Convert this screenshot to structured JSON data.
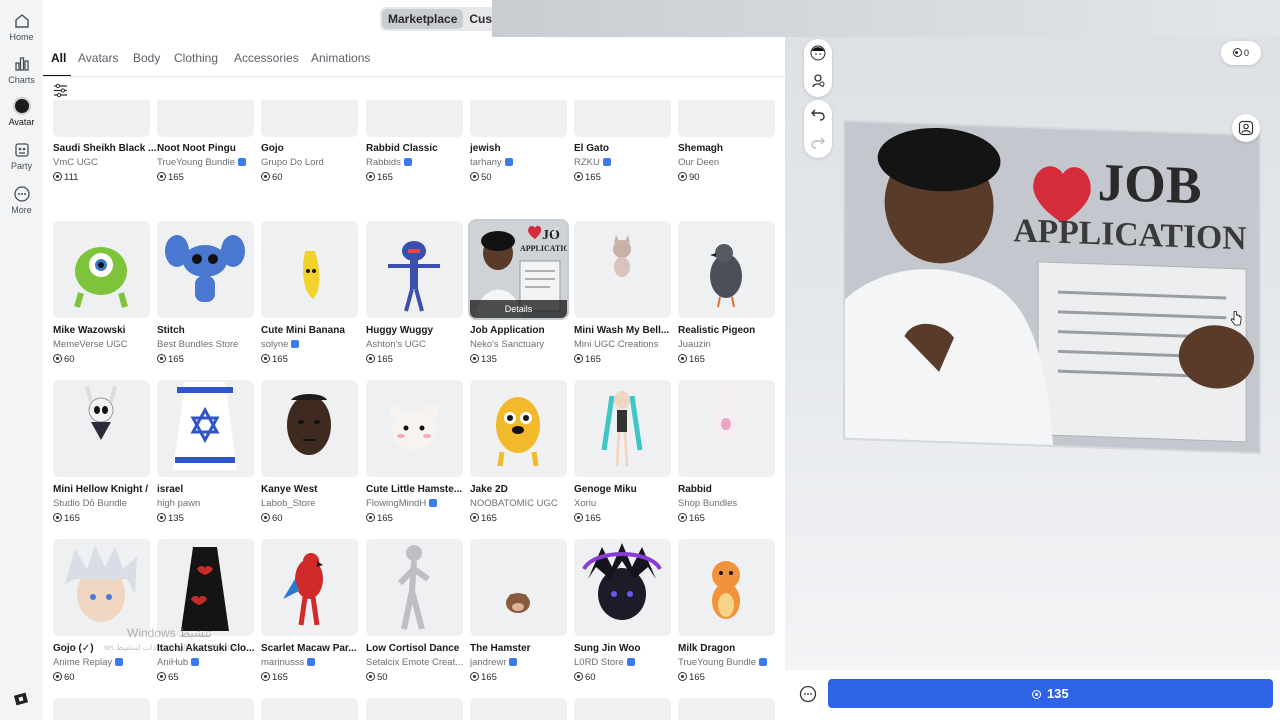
{
  "nav": {
    "items": [
      {
        "label": "Home",
        "icon": "home-icon"
      },
      {
        "label": "Charts",
        "icon": "charts-icon"
      },
      {
        "label": "Avatar",
        "icon": "avatar-icon"
      },
      {
        "label": "Party",
        "icon": "party-icon"
      },
      {
        "label": "More",
        "icon": "more-icon"
      }
    ],
    "active": "Avatar"
  },
  "topbar": {
    "marketplace_label": "Marketplace",
    "customize_label": "Customize",
    "active_tab": "Marketplace",
    "search_icon": "search-icon"
  },
  "categories": {
    "items": [
      "All",
      "Avatars",
      "Body",
      "Clothing",
      "Accessories",
      "Animations"
    ],
    "active": "All"
  },
  "items": [
    {
      "name": "Saudi Sheikh Black ...",
      "creator": "VmC UGC",
      "verified": false,
      "price": "111",
      "icon": "black-robe"
    },
    {
      "name": "Noot Noot Pingu",
      "creator": "TrueYoung Bundle",
      "verified": true,
      "price": "165",
      "icon": "penguin"
    },
    {
      "name": "Gojo",
      "creator": "Grupo Do Lord",
      "verified": false,
      "price": "60",
      "icon": "head-blindfold"
    },
    {
      "name": "Rabbid Classic",
      "creator": "Rabbids",
      "verified": true,
      "price": "165",
      "icon": "rabbit"
    },
    {
      "name": "jewish",
      "creator": "tarhany",
      "verified": true,
      "price": "50",
      "icon": "flag"
    },
    {
      "name": "El Gato",
      "creator": "RZKU",
      "verified": true,
      "price": "165",
      "icon": "cat"
    },
    {
      "name": "Shemagh",
      "creator": "Our Deen",
      "verified": false,
      "price": "90",
      "icon": "scarf"
    },
    {
      "name": "Mike Wazowski",
      "creator": "MemeVerse UGC",
      "verified": false,
      "price": "60",
      "icon": "green-monster"
    },
    {
      "name": "Stitch",
      "creator": "Best Bundles Store",
      "verified": false,
      "price": "165",
      "icon": "blue-alien"
    },
    {
      "name": "Cute Mini Banana",
      "creator": "solyne",
      "verified": true,
      "price": "165",
      "icon": "banana"
    },
    {
      "name": "Huggy Wuggy",
      "creator": "Ashton's UGC",
      "verified": false,
      "price": "165",
      "icon": "blue-figure"
    },
    {
      "name": "Job Application",
      "creator": "Neko's Sanctuary",
      "verified": false,
      "price": "135",
      "icon": "photo",
      "selected": true,
      "details_label": "Details"
    },
    {
      "name": "Mini Wash My Bell...",
      "creator": "Mini UGC Creations",
      "verified": false,
      "price": "165",
      "icon": "small-cat"
    },
    {
      "name": "Realistic Pigeon",
      "creator": "Juauzin",
      "verified": false,
      "price": "165",
      "icon": "pigeon"
    },
    {
      "name": "Mini Hellow Knight /",
      "creator": "Studio Dō Bundle",
      "verified": false,
      "price": "165",
      "icon": "knight"
    },
    {
      "name": "israel",
      "creator": "high pawn",
      "verified": false,
      "price": "135",
      "icon": "flag-cape"
    },
    {
      "name": "Kanye West",
      "creator": "Labob_Store",
      "verified": false,
      "price": "60",
      "icon": "face"
    },
    {
      "name": "Cute Little Hamste...",
      "creator": "FlowingMindH",
      "verified": true,
      "price": "165",
      "icon": "hamster-head"
    },
    {
      "name": "Jake 2D",
      "creator": "NOOBATOMIC UGC",
      "verified": false,
      "price": "165",
      "icon": "yellow-dog"
    },
    {
      "name": "Genoge Miku",
      "creator": "Xoriu",
      "verified": false,
      "price": "165",
      "icon": "anime-girl"
    },
    {
      "name": "Rabbid",
      "creator": "Shop Bundles",
      "verified": false,
      "price": "165",
      "icon": "rabbit"
    },
    {
      "name": "Gojo (✓)",
      "creator": "Anime Replay",
      "verified": true,
      "price": "60",
      "icon": "white-hair"
    },
    {
      "name": "Itachi Akatsuki Clo...",
      "creator": "AniHub",
      "verified": true,
      "price": "65",
      "icon": "black-cloak"
    },
    {
      "name": "Scarlet Macaw Par...",
      "creator": "marinusss",
      "verified": true,
      "price": "165",
      "icon": "parrot"
    },
    {
      "name": "Low Cortisol Dance",
      "creator": "Setalcix Emote Creat...",
      "verified": false,
      "price": "50",
      "icon": "grey-figure"
    },
    {
      "name": "The Hamster",
      "creator": "jandrewr",
      "verified": true,
      "price": "165",
      "icon": "tiny-hamster"
    },
    {
      "name": "Sung Jin Woo",
      "creator": "L0RD Store",
      "verified": true,
      "price": "60",
      "icon": "dark-hair"
    },
    {
      "name": "Milk Dragon",
      "creator": "TrueYoung Bundle",
      "verified": true,
      "price": "165",
      "icon": "orange-dragon"
    }
  ],
  "preview": {
    "robux_balance": "0",
    "buy_price": "135"
  },
  "watermark": {
    "line1": "Windows تنشيط",
    "line2": "ws انتقل إلى الإعدادات لتنشيط Windows"
  }
}
